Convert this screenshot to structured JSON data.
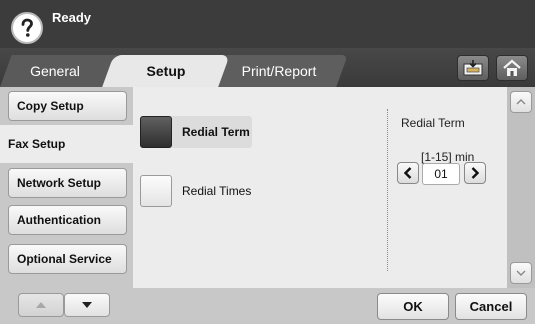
{
  "status": {
    "text": "Ready"
  },
  "tabs": [
    {
      "label": "General",
      "active": false
    },
    {
      "label": "Setup",
      "active": true
    },
    {
      "label": "Print/Report",
      "active": false
    }
  ],
  "header_icons": [
    "print-report-icon",
    "home-icon"
  ],
  "sidebar": {
    "items": [
      {
        "label": "Copy Setup",
        "active": false
      },
      {
        "label": "Fax Setup",
        "active": true
      },
      {
        "label": "Network Setup",
        "active": false
      },
      {
        "label": "Authentication",
        "active": false
      },
      {
        "label": "Optional Service",
        "active": false
      }
    ]
  },
  "options": [
    {
      "label": "Redial Term",
      "selected": true
    },
    {
      "label": "Redial Times",
      "selected": false
    }
  ],
  "setting": {
    "title": "Redial Term",
    "range": "[1-15] min",
    "value": "01"
  },
  "buttons": {
    "ok": "OK",
    "cancel": "Cancel"
  },
  "colors": {
    "header": "#3c3c3c",
    "panel": "#ececec",
    "sidebar": "#c8c8c8"
  }
}
